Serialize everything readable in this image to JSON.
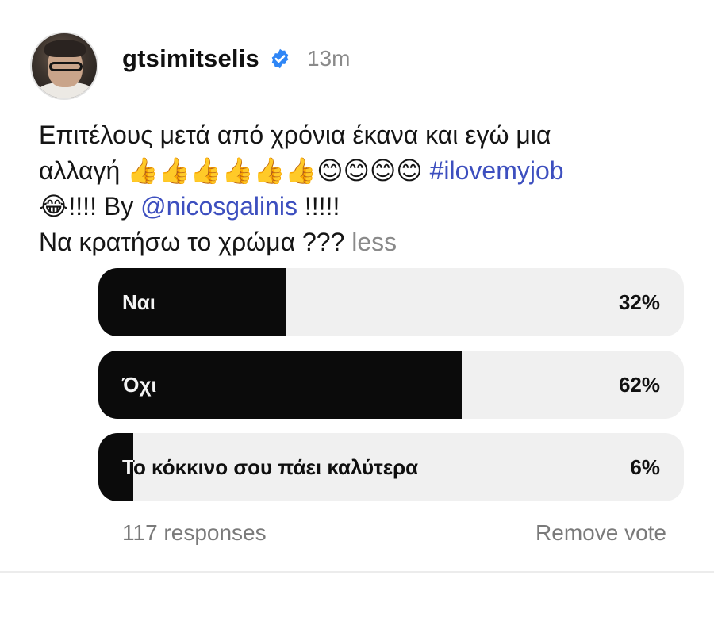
{
  "post": {
    "username": "gtsimitselis",
    "time": "13m",
    "caption": {
      "line1": "Επιτέλους μετά από χρόνια έκανα και εγώ μια",
      "line2_text": "αλλαγή ",
      "line2_emojis": "👍👍👍👍👍👍😊😊😊😊",
      "hashtag": "#ilovemyjob",
      "line3_emoji": "😂",
      "line3_text": "!!!! By ",
      "mention": "@nicosgalinis",
      "line3_end": " !!!!!",
      "line4": "Να κρατήσω το χρώμα ??? ",
      "less": "less"
    }
  },
  "poll": {
    "options": [
      {
        "label": "Ναι",
        "percent": "32%",
        "fill_fraction": 0.32
      },
      {
        "label": "Όχι",
        "percent": "62%",
        "fill_fraction": 0.62
      },
      {
        "label": "Το κόκκινο σου πάει καλύτερα",
        "percent": "6%",
        "fill_fraction": 0.06
      }
    ],
    "responses": "117 responses",
    "remove_vote": "Remove vote"
  },
  "colors": {
    "bar_fill": "#0b0b0b",
    "bar_track": "#f0f0f0",
    "link": "#3d4fbf",
    "verified": "#2f86f6",
    "muted": "#8a8a8a"
  },
  "icons": {
    "verified": "verified-badge-icon"
  }
}
